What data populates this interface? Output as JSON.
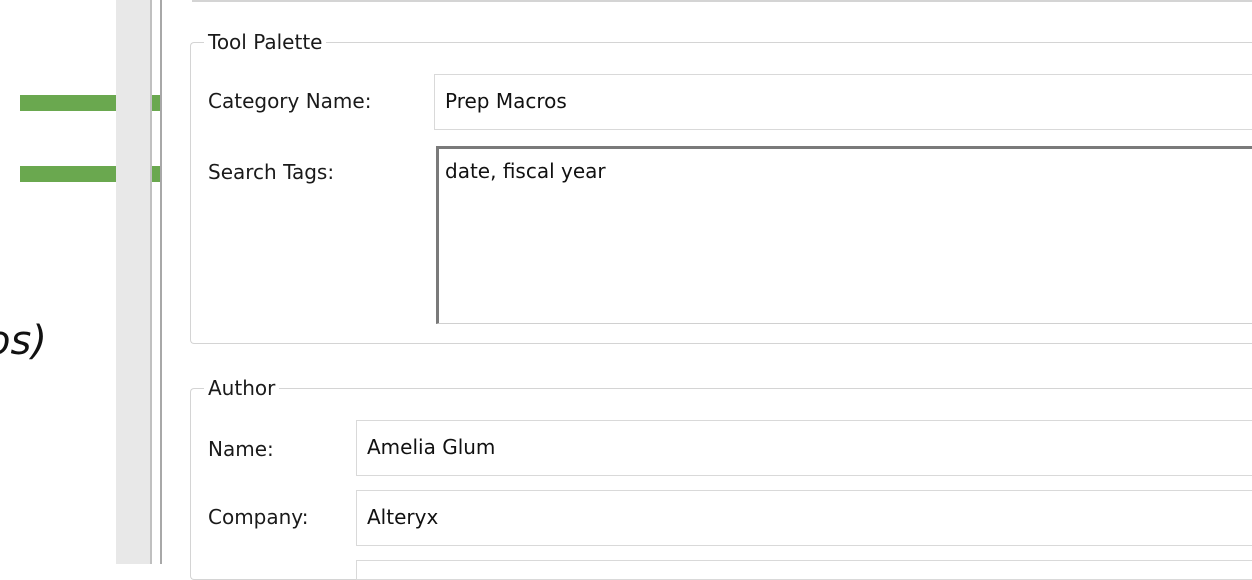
{
  "annotation_text": "os)",
  "tool_palette": {
    "title": "Tool Palette",
    "category_label": "Category Name:",
    "category_value": "Prep Macros",
    "search_tags_label": "Search Tags:",
    "search_tags_value": "date, fiscal year"
  },
  "author": {
    "title": "Author",
    "name_label": "Name:",
    "name_value": "Amelia Glum",
    "company_label": "Company:",
    "company_value": "Alteryx"
  },
  "colors": {
    "arrow": "#6aa84f",
    "group_border": "#d4d4d4"
  }
}
